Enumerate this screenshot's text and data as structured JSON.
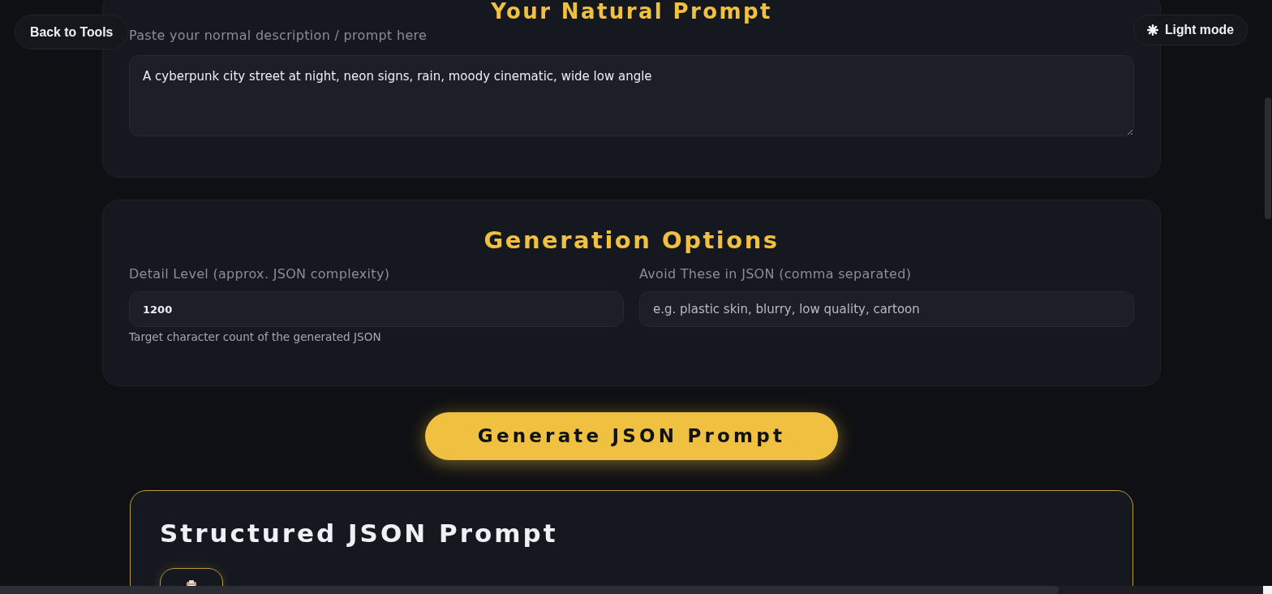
{
  "top_bar": {
    "back_button": "Back to Tools",
    "theme_toggle": "Light mode"
  },
  "prompt_section": {
    "title": "Your Natural Prompt",
    "label": "Paste your normal description / prompt here",
    "value": "A cyberpunk city street at night, neon signs, rain, moody cinematic, wide low angle"
  },
  "options_section": {
    "title": "Generation Options",
    "fields": [
      {
        "label": "Detail Level (approx. JSON complexity)",
        "value": "1200",
        "help": "Target character count of the generated JSON"
      },
      {
        "label": "Avoid These in JSON (comma separated)",
        "placeholder": "e.g. plastic skin, blurry, low quality, cartoon"
      }
    ]
  },
  "generate_button": "Generate JSON Prompt",
  "result": {
    "title": "Structured JSON Prompt"
  }
}
